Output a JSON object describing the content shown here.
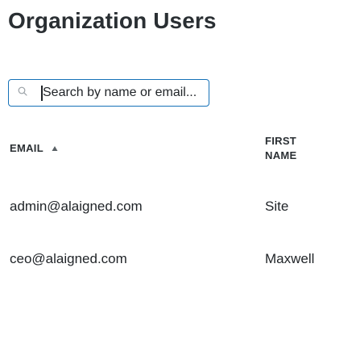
{
  "page": {
    "title": "Organization Users"
  },
  "search": {
    "placeholder": "Search by name or email...",
    "value": ""
  },
  "table": {
    "columns": [
      {
        "label": "EMAIL",
        "sorted": "ascending"
      },
      {
        "label": "FIRST NAME"
      }
    ],
    "rows": [
      {
        "email": "admin@alaigned.com",
        "first_name": "Site"
      },
      {
        "email": "ceo@alaigned.com",
        "first_name": "Maxwell"
      }
    ]
  },
  "icons": {
    "search": "search-icon",
    "sort": "sort-ascending-icon"
  },
  "colors": {
    "focus_border": "#1672b8",
    "text": "#1f2327"
  }
}
